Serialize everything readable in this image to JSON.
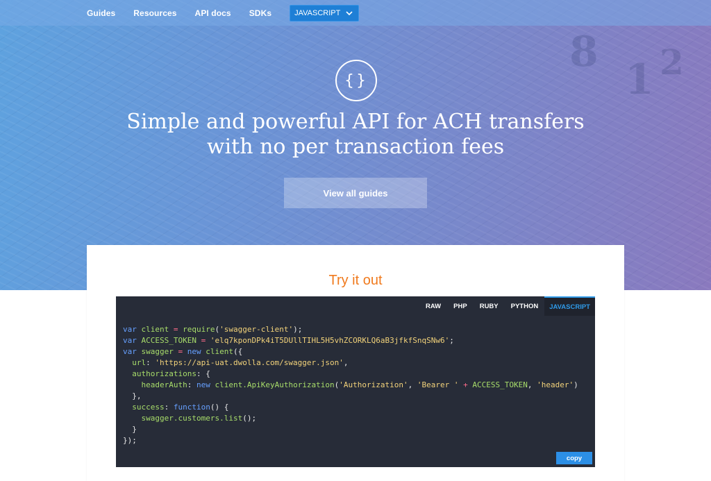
{
  "nav": {
    "items": [
      {
        "label": "Guides"
      },
      {
        "label": "Resources"
      },
      {
        "label": "API docs"
      },
      {
        "label": "SDKs"
      }
    ],
    "language_select": "JAVASCRIPT"
  },
  "hero": {
    "icon": "curly-braces-icon",
    "icon_glyph": "{}",
    "title_line1": "Simple and powerful API for ACH transfers",
    "title_line2": "with no per transaction fees",
    "button_label": "View all guides"
  },
  "try_it": {
    "title": "Try it out",
    "tabs": [
      "RAW",
      "PHP",
      "RUBY",
      "PYTHON",
      "JAVASCRIPT"
    ],
    "active_tab": "JAVASCRIPT",
    "code_lines": [
      "var client = require('swagger-client');",
      "var ACCESS_TOKEN = 'elq7kponDPk4iT5DUllTIHL5H5vhZCORKLQ6aB3jfkfSnqSNw6';",
      "var swagger = new client({",
      "  url: 'https://api-uat.dwolla.com/swagger.json',",
      "  authorizations: {",
      "    headerAuth: new client.ApiKeyAuthorization('Authorization', 'Bearer ' + ACCESS_TOKEN, 'header')",
      "  },",
      "  success: function() {",
      "    swagger.customers.list();",
      "  }",
      "});"
    ],
    "copy_label": "copy"
  },
  "colors": {
    "accent": "#1e7fd6",
    "title_orange": "#f07a1d",
    "code_bg": "#272c38"
  }
}
